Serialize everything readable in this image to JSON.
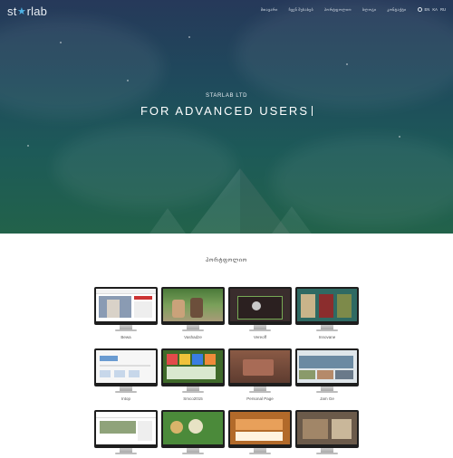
{
  "brand": {
    "logo_text": "starlab"
  },
  "nav": {
    "items": [
      "მთავარი",
      "ჩვენ შესახებ",
      "პორტფოლიო",
      "ბლოგი",
      "კონტაქტი"
    ],
    "langs": [
      "EN",
      "KA",
      "RU"
    ]
  },
  "hero": {
    "tagline": "STARLAB LTD",
    "headline": "FOR ADVANCED USERS"
  },
  "portfolio": {
    "title": "პორტფოლიო",
    "projects": [
      {
        "label": "Bewa",
        "theme": "news"
      },
      {
        "label": "Vashadze",
        "theme": "garden"
      },
      {
        "label": "Vereoff",
        "theme": "dark"
      },
      {
        "label": "Innovane",
        "theme": "teal"
      },
      {
        "label": "Intop",
        "theme": "light"
      },
      {
        "label": "Smco2015",
        "theme": "colorful"
      },
      {
        "label": "Personal Page",
        "theme": "brown"
      },
      {
        "label": "Jam Ge",
        "theme": "photo"
      },
      {
        "label": "",
        "theme": "clean"
      },
      {
        "label": "",
        "theme": "green"
      },
      {
        "label": "",
        "theme": "orange"
      },
      {
        "label": "",
        "theme": "interior"
      }
    ]
  }
}
